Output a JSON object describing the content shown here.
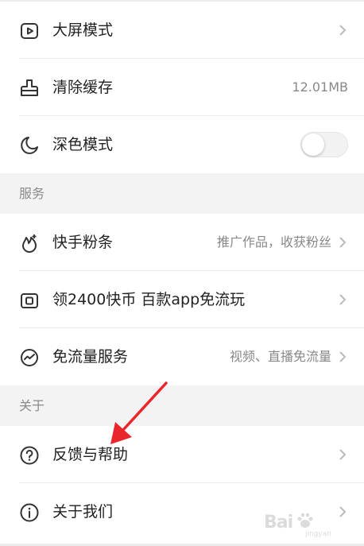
{
  "settings": {
    "rows": [
      {
        "label": "大屏模式",
        "icon": "play-screen-icon"
      },
      {
        "label": "清除缓存",
        "icon": "brush-icon",
        "value": "12.01MB"
      },
      {
        "label": "深色模式",
        "icon": "moon-icon",
        "toggle_on": false
      }
    ]
  },
  "services": {
    "title": "服务",
    "rows": [
      {
        "label": "快手粉条",
        "icon": "fire-icon",
        "value": "推广作品，收获粉丝"
      },
      {
        "label": "领2400快币 百款app免流玩",
        "icon": "card-icon"
      },
      {
        "label": "免流量服务",
        "icon": "wave-circle-icon",
        "value": "视频、直播免流量"
      }
    ]
  },
  "about": {
    "title": "关于",
    "rows": [
      {
        "label": "反馈与帮助",
        "icon": "question-icon"
      },
      {
        "label": "关于我们",
        "icon": "info-icon"
      }
    ]
  },
  "watermark": {
    "text": "Bai",
    "sub": "jingyan"
  },
  "colors": {
    "arrow": "#e8262b",
    "text": "#222222",
    "muted": "#888888",
    "section_bg": "#f3f3f3"
  }
}
